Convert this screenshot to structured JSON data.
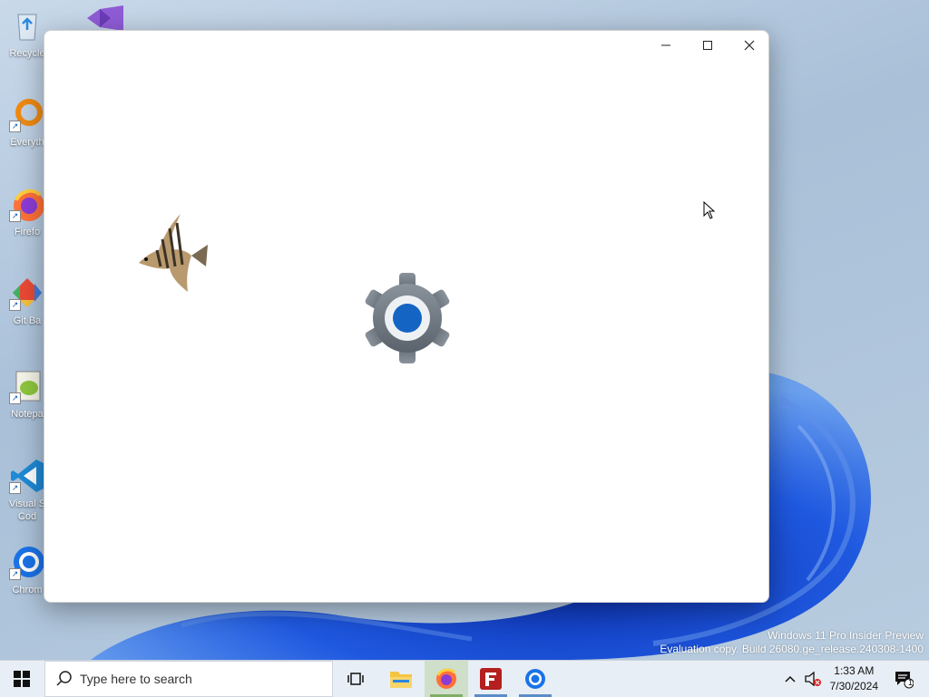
{
  "desktop": {
    "icons": [
      {
        "label": "Recycle"
      },
      {
        "label": "Everyth"
      },
      {
        "label": "Firefo"
      },
      {
        "label": "Git Ba"
      },
      {
        "label": "Notepa"
      },
      {
        "label": "Visual S Cod"
      },
      {
        "label": "Chrom"
      }
    ],
    "watermark": {
      "line1": "Windows 11 Pro Insider Preview",
      "line2": "Evaluation copy. Build 26080.ge_release.240308-1400"
    }
  },
  "window": {
    "minimize_glyph": "—",
    "maximize_glyph": "☐",
    "close_glyph": "✕",
    "content_icon": "settings-gear-icon"
  },
  "taskbar": {
    "search_placeholder": "Type here to search",
    "apps": [
      {
        "name": "task-view"
      },
      {
        "name": "file-explorer"
      },
      {
        "name": "firefox"
      },
      {
        "name": "filezilla"
      },
      {
        "name": "chrome"
      }
    ],
    "clock": {
      "time": "1:33 AM",
      "date": "7/30/2024"
    },
    "notification_count": "1"
  },
  "colors": {
    "accent": "#0067c0",
    "gear": "#6e7782",
    "wallpaper_blue": "#1a4fd6"
  }
}
